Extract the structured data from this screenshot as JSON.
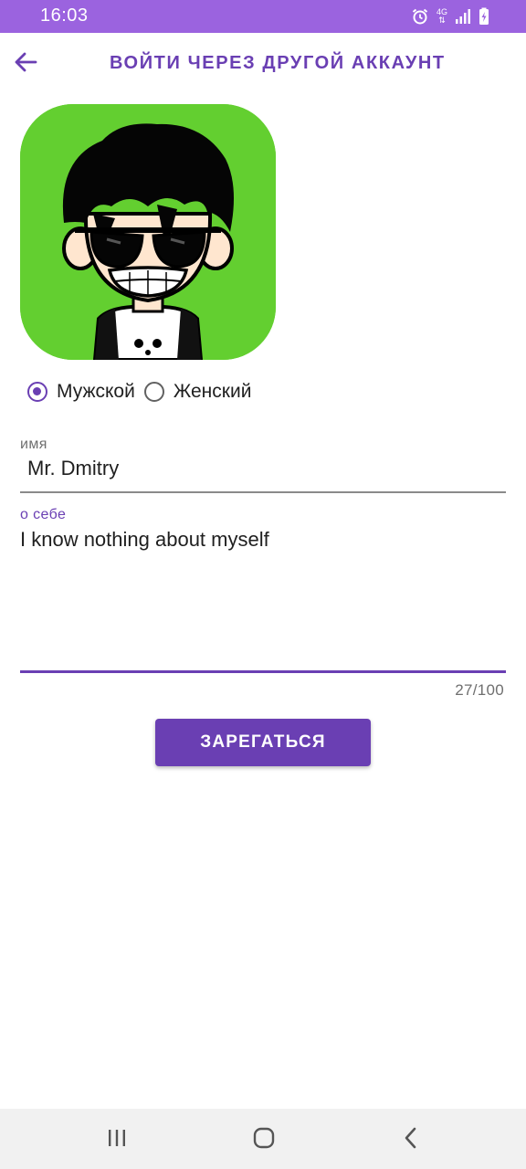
{
  "status_bar": {
    "time": "16:03",
    "network_type": "4G",
    "icons": [
      "alarm-icon",
      "network-4g-icon",
      "signal-icon",
      "battery-charging-icon"
    ]
  },
  "app_bar": {
    "back_icon": "arrow-left-icon",
    "title": "ВОЙТИ ЧЕРЕЗ ДРУГОЙ АККАУНТ"
  },
  "avatar": {
    "description_icon": "avatar-cartoon-icon",
    "background_color": "#63cf30"
  },
  "gender": {
    "options": [
      {
        "label": "Мужской",
        "checked": true
      },
      {
        "label": "Женский",
        "checked": false
      }
    ]
  },
  "name_field": {
    "label": "имя",
    "value": "Mr. Dmitry"
  },
  "about_field": {
    "label": "о себе",
    "value": "I know nothing about myself",
    "counter": "27/100"
  },
  "submit": {
    "label": "ЗАРЕГАТЬСЯ"
  },
  "nav_bar": {
    "icons": [
      "recents-icon",
      "home-icon",
      "back-icon"
    ]
  },
  "colors": {
    "accent": "#6a3fb3",
    "status_bar": "#9b63df",
    "nav_bar": "#f1f1f1"
  }
}
